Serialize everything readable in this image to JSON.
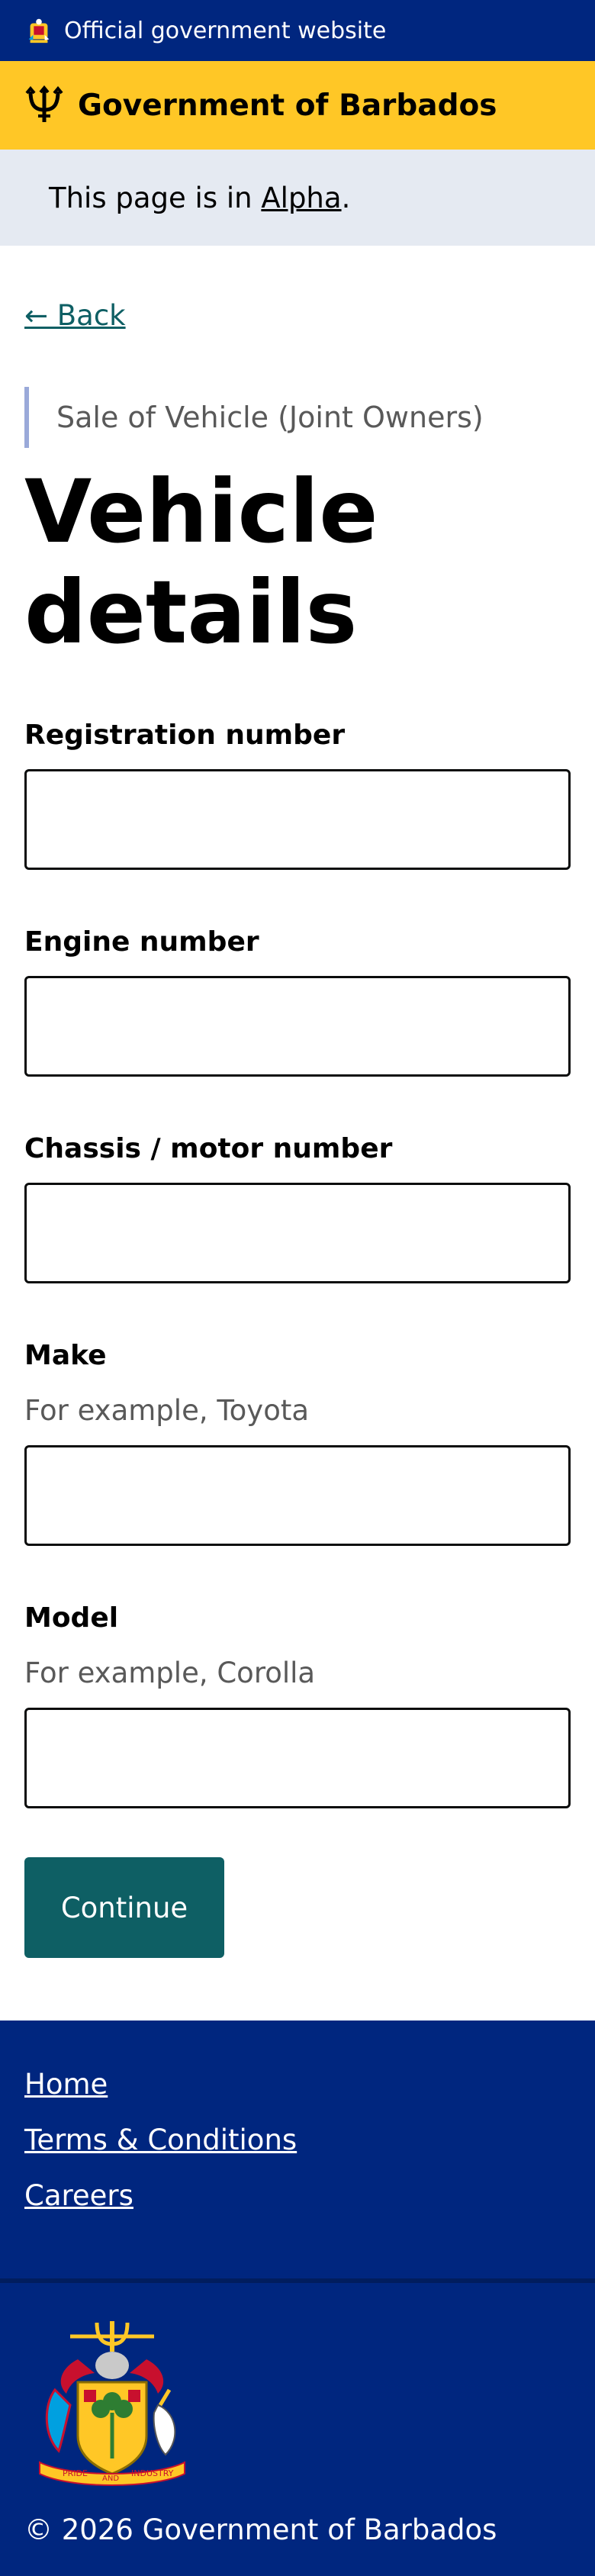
{
  "header": {
    "official_label": "Official government website",
    "brand_name": "Government of Barbados"
  },
  "banner": {
    "prefix": "This page is in ",
    "phase_link": "Alpha",
    "suffix": "."
  },
  "nav": {
    "back_label": "← Back"
  },
  "page": {
    "caption": "Sale of Vehicle (Joint Owners)",
    "title": "Vehicle details"
  },
  "form": {
    "fields": [
      {
        "label": "Registration number",
        "hint": "",
        "value": ""
      },
      {
        "label": "Engine number",
        "hint": "",
        "value": ""
      },
      {
        "label": "Chassis / motor number",
        "hint": "",
        "value": ""
      },
      {
        "label": "Make",
        "hint": "For example, Toyota",
        "value": ""
      },
      {
        "label": "Model",
        "hint": "For example, Corolla",
        "value": ""
      }
    ],
    "continue_label": "Continue"
  },
  "footer": {
    "links": [
      "Home",
      "Terms & Conditions",
      "Careers"
    ],
    "copyright": "© 2026 Government of Barbados",
    "crest_text": {
      "left": "PRIDE",
      "middle": "AND",
      "right": "INDUSTRY"
    }
  },
  "colors": {
    "topbar": "#00267f",
    "brandbar": "#ffc726",
    "banner": "#e5eaf2",
    "accent": "#0e5f64",
    "caption_border": "#9aa9d9"
  },
  "icons": {
    "topbar": "barbados-crest-icon",
    "brand": "trident-icon",
    "footer": "coat-of-arms-icon"
  }
}
